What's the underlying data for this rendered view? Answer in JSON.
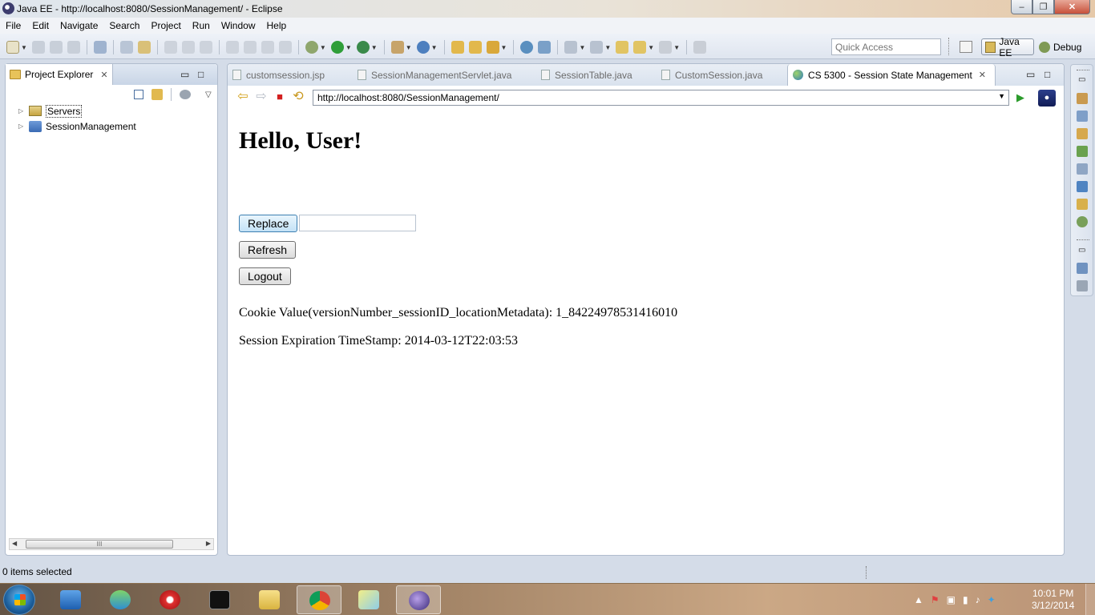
{
  "window": {
    "title": "Java EE - http://localhost:8080/SessionManagement/ - Eclipse",
    "minimize": "–",
    "maximize": "❐",
    "close": "✕"
  },
  "menu": [
    "File",
    "Edit",
    "Navigate",
    "Search",
    "Project",
    "Run",
    "Window",
    "Help"
  ],
  "toolbar": {
    "quick_access_placeholder": "Quick Access",
    "perspectives": {
      "java_ee": "Java EE",
      "debug": "Debug"
    }
  },
  "explorer": {
    "tab_label": "Project Explorer",
    "close": "✕",
    "minimize": "▭",
    "maximize": "□",
    "items": [
      {
        "label": "Servers"
      },
      {
        "label": "SessionManagement"
      }
    ],
    "scroll_thumb": "III"
  },
  "editor": {
    "tabs": [
      {
        "label": "customsession.jsp"
      },
      {
        "label": "SessionManagementServlet.java"
      },
      {
        "label": "SessionTable.java"
      },
      {
        "label": "CustomSession.java"
      },
      {
        "label": "CS 5300 - Session State Management"
      }
    ],
    "tab_close": "✕",
    "minimize": "▭",
    "maximize": "□",
    "url": "http://localhost:8080/SessionManagement/",
    "nav": {
      "back": "⇦",
      "forward": "⇨",
      "stop": "■",
      "refresh": "⟲",
      "go": "▶"
    }
  },
  "page": {
    "heading": "Hello, User!",
    "replace_button": "Replace",
    "replace_value": "",
    "refresh_button": "Refresh",
    "logout_button": "Logout",
    "cookie_text": "Cookie Value(versionNumber_sessionID_locationMetadata): 1_84224978531416010",
    "expiration_text": "Session Expiration TimeStamp: 2014-03-12T22:03:53"
  },
  "status": {
    "text": "0 items selected"
  },
  "taskbar": {
    "clock_time": "10:01 PM",
    "clock_date": "3/12/2014"
  },
  "colors": {
    "accent": "#3c7fb1",
    "panel_border": "#b0bccd",
    "stop_red": "#d32020"
  }
}
